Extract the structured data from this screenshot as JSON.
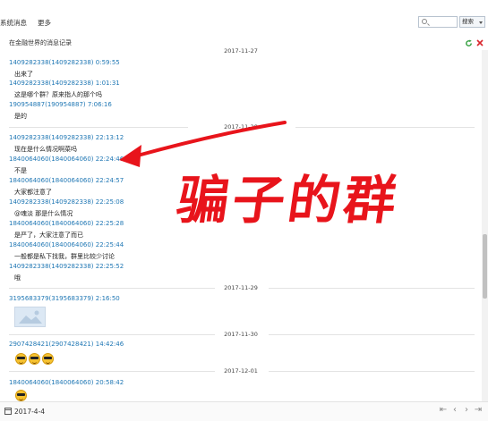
{
  "menu": {
    "system_messages": "系统消息",
    "more": "更多"
  },
  "search": {
    "placeholder": "",
    "button_label": "搜索"
  },
  "record": {
    "title": "在金融世界的消息记录"
  },
  "messages": [
    {
      "sender": "1409282338(1409282338) 0:59:55",
      "text": "出来了"
    },
    {
      "sender": "1409282338(1409282338) 1:01:31",
      "text": "这是哪个群？原来指人的那个吗"
    },
    {
      "sender": "190954887(190954887) 7:06:16",
      "text": "是的"
    },
    {
      "sender": "1409282338(1409282338) 22:13:12",
      "text": "现在是什么情况啊菜吗"
    },
    {
      "sender": "1840064060(1840064060) 22:24:46",
      "text": "不是"
    },
    {
      "sender": "1840064060(1840064060) 22:24:57",
      "text": "大家都注意了"
    },
    {
      "sender": "1409282338(1409282338) 22:25:08",
      "text": "@魂淡 那是什么情况"
    },
    {
      "sender": "1840064060(1840064060) 22:25:28",
      "text": "是严了，大家注意了而已"
    },
    {
      "sender": "1840064060(1840064060) 22:25:44",
      "text": "一般都是私下找我，群里比较少讨论"
    },
    {
      "sender": "1409282338(1409282338) 22:25:52",
      "text": "哦"
    },
    {
      "sender": "3195683379(3195683379) 2:16:50",
      "text": ""
    },
    {
      "sender": "2907428421(2907428421) 14:42:46",
      "text": ""
    },
    {
      "sender": "1840064060(1840064060) 20:58:42",
      "text": ""
    }
  ],
  "date_separators": [
    "2017-11-27",
    "2017-11-28",
    "2017-11-29",
    "2017-11-30",
    "2017-12-01"
  ],
  "emoji_icons": [
    "sunglasses-emoji",
    "sunglasses-emoji",
    "sunglasses-emoji",
    "sunglasses-emoji"
  ],
  "footer": {
    "date_value": "2017-4-4"
  },
  "annotation": {
    "text": "骗子的群",
    "color": "#e8141b"
  },
  "colors": {
    "sender": "#1f77b4",
    "accent_green": "#2e9d3a",
    "accent_red": "#d9262c"
  }
}
